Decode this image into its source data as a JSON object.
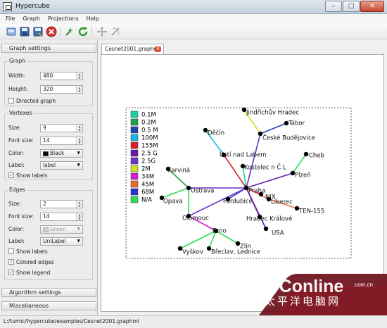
{
  "window": {
    "title": "Hypercube",
    "minimize": "–",
    "maximize": "□",
    "close": "✕"
  },
  "menu": [
    "File",
    "Graph",
    "Projections",
    "Help"
  ],
  "toolbar": {
    "icons": [
      "new-file-icon",
      "save-icon",
      "save-as-icon",
      "close-file-icon",
      "transform-icon",
      "reload-icon",
      "move-icon",
      "rotate-icon"
    ]
  },
  "left_panel": {
    "graph_settings_header": "Graph settings",
    "graph": {
      "title": "Graph",
      "width_label": "Width:",
      "width_value": "480",
      "height_label": "Height:",
      "height_value": "320",
      "directed_label": "Directed graph"
    },
    "vertexes": {
      "title": "Vertexes",
      "size_label": "Size:",
      "size_value": "9",
      "font_size_label": "Font size:",
      "font_size_value": "14",
      "color_label": "Color:",
      "color_value": "Black",
      "label_label": "Label:",
      "label_value": "label",
      "show_labels": "Show labels"
    },
    "edges": {
      "title": "Edges",
      "size_label": "Size:",
      "size_value": "2",
      "font_size_label": "Font size:",
      "font_size_value": "14",
      "color_label": "Color:",
      "color_value": "Green",
      "label_label": "Label:",
      "label_value": "UniLabel",
      "show_labels": "Show labels",
      "colored_edges": "Colored edges",
      "show_legend": "Show legend"
    },
    "algorithm_settings_header": "Algorithm settings",
    "misc_header": "Miscellaneous"
  },
  "tab": {
    "label": "Cesnet2001.graphml"
  },
  "graph_canvas": {
    "legend": [
      {
        "label": "0.1M",
        "color": "#1ad2a4"
      },
      {
        "label": "0.2M",
        "color": "#1fa24c"
      },
      {
        "label": "0.5 M",
        "color": "#2244b8"
      },
      {
        "label": "100M",
        "color": "#18b7e8"
      },
      {
        "label": "155M",
        "color": "#dc1f26"
      },
      {
        "label": "2.5 G",
        "color": "#6a18a8"
      },
      {
        "label": "2.5G",
        "color": "#6b35c8"
      },
      {
        "label": "2M",
        "color": "#cde32a"
      },
      {
        "label": "34M",
        "color": "#d31dd3"
      },
      {
        "label": "45M",
        "color": "#e2702a"
      },
      {
        "label": "68M",
        "color": "#2b2fd6"
      },
      {
        "label": "N/A",
        "color": "#2fdc54"
      }
    ],
    "nodes": [
      "Jindřichův Hradec",
      "Tábor",
      "České Budějovice",
      "Děčín",
      "Ústí nad Labem",
      "Kostelec n Č L",
      "Cheb",
      "Plzeň",
      "Karviná",
      "Ostrava",
      "Praha",
      "NIX",
      "Pardubice",
      "Liberec",
      "TEN-155",
      "Opava",
      "Hradec Králové",
      "Olomouc",
      "USA",
      "Brno",
      "Zlín",
      "Vyškov",
      "Břeclav, Lednice"
    ]
  },
  "status": {
    "path": "L:/tumic/hypercube/examples/Cesnet2001.graphml"
  },
  "watermark": {
    "brand": "PConline",
    "domain": ".com.cn",
    "chinese": "太平洋电脑网"
  }
}
